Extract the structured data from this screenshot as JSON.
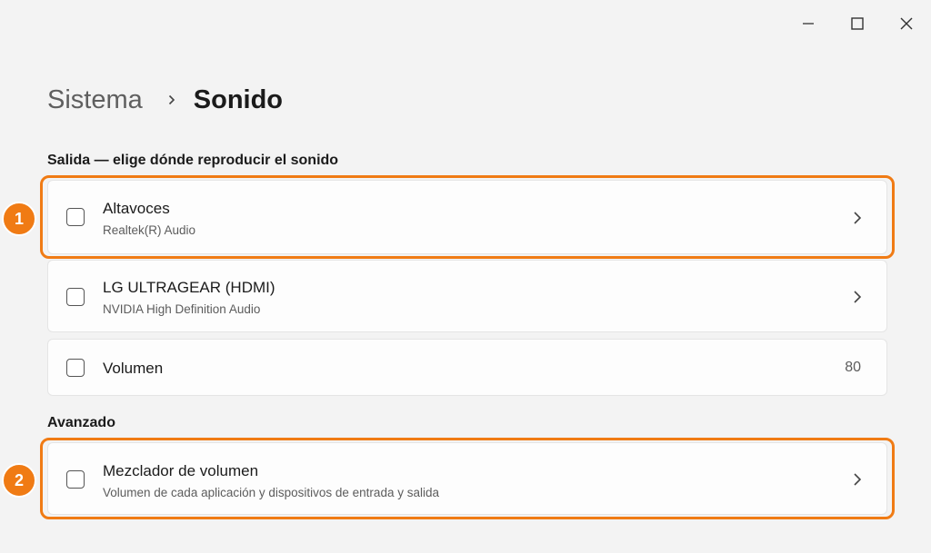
{
  "window": {
    "controls": {
      "minimize_icon": "minimize-icon",
      "maximize_icon": "maximize-icon",
      "close_icon": "close-icon"
    }
  },
  "breadcrumb": {
    "parent": "Sistema",
    "current": "Sonido",
    "separator_icon": "chevron-right-icon"
  },
  "sections": {
    "output": {
      "title": "Salida — elige dónde reproducir el sonido",
      "items": [
        {
          "title": "Altavoces",
          "subtitle": "Realtek(R) Audio",
          "icon": "chevron-right-icon",
          "checked": false
        },
        {
          "title": "LG ULTRAGEAR (HDMI)",
          "subtitle": "NVIDIA High Definition Audio",
          "icon": "chevron-right-icon",
          "checked": false
        },
        {
          "title": "Volumen",
          "value": "80",
          "checked": false
        }
      ]
    },
    "advanced": {
      "title": "Avanzado",
      "items": [
        {
          "title": "Mezclador de volumen",
          "subtitle": "Volumen de cada aplicación y dispositivos de entrada y salida",
          "icon": "chevron-right-icon",
          "checked": false
        }
      ]
    }
  },
  "annotations": [
    {
      "label": "1",
      "color": "#f07b14"
    },
    {
      "label": "2",
      "color": "#f07b14"
    }
  ]
}
